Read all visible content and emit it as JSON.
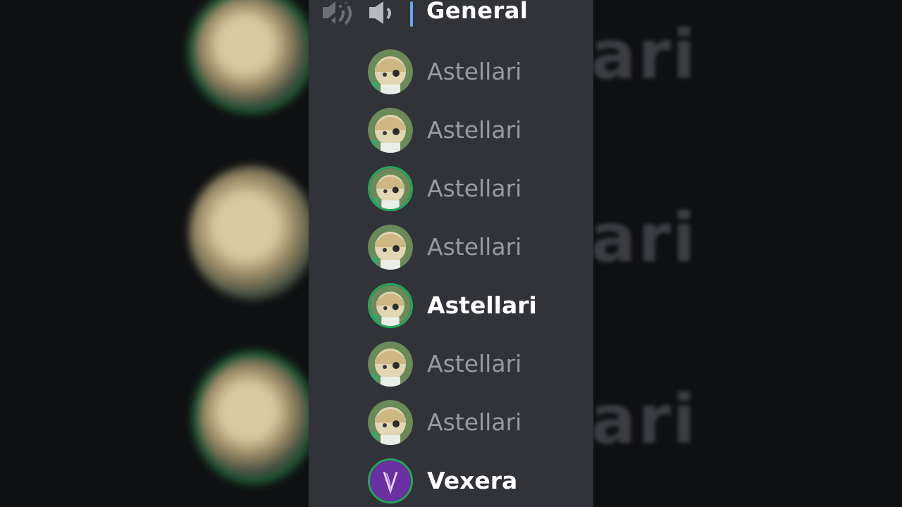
{
  "channel": {
    "name": "General",
    "icons": [
      "deafen-icon",
      "speaker-icon"
    ]
  },
  "members": [
    {
      "name": "Astellari",
      "speaking": false,
      "active": false
    },
    {
      "name": "Astellari",
      "speaking": false,
      "active": false
    },
    {
      "name": "Astellari",
      "speaking": true,
      "active": false
    },
    {
      "name": "Astellari",
      "speaking": false,
      "active": false
    },
    {
      "name": "Astellari",
      "speaking": true,
      "active": true
    },
    {
      "name": "Astellari",
      "speaking": false,
      "active": false
    },
    {
      "name": "Astellari",
      "speaking": false,
      "active": false
    },
    {
      "name": "Vexera",
      "speaking": true,
      "active": true
    }
  ],
  "colors": {
    "panel": "#313338",
    "speaking_ring": "#23a55a",
    "muted_text": "#949ba4",
    "active_text": "#ffffff",
    "vexera_avatar": "#6a2fa0"
  }
}
